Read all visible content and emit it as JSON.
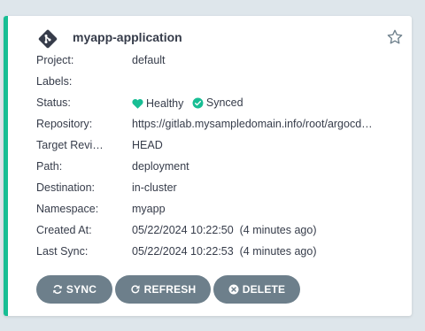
{
  "app": {
    "name": "myapp-application"
  },
  "fields": {
    "project_label": "Project:",
    "project_value": "default",
    "labels_label": "Labels:",
    "labels_value": "",
    "status_label": "Status:",
    "health": "Healthy",
    "sync": "Synced",
    "repository_label": "Repository:",
    "repository_value": "https://gitlab.mysampledomain.info/root/argocd…",
    "target_label": "Target Revi…",
    "target_value": "HEAD",
    "path_label": "Path:",
    "path_value": "deployment",
    "destination_label": "Destination:",
    "destination_value": "in-cluster",
    "namespace_label": "Namespace:",
    "namespace_value": "myapp",
    "created_label": "Created At:",
    "created_value": "05/22/2024 10:22:50  (4 minutes ago)",
    "lastsync_label": "Last Sync:",
    "lastsync_value": "05/22/2024 10:22:53  (4 minutes ago)"
  },
  "buttons": {
    "sync": "SYNC",
    "refresh": "REFRESH",
    "delete": "DELETE"
  },
  "colors": {
    "accent": "#18be94",
    "button": "#6d7f8b",
    "text": "#363c4a"
  },
  "icons": {
    "app": "git-diamond-icon",
    "favorite": "star-outline-icon",
    "health": "heart-icon",
    "sync_status": "check-circle-icon",
    "sync": "sync-icon",
    "refresh": "refresh-icon",
    "delete": "times-circle-icon"
  }
}
